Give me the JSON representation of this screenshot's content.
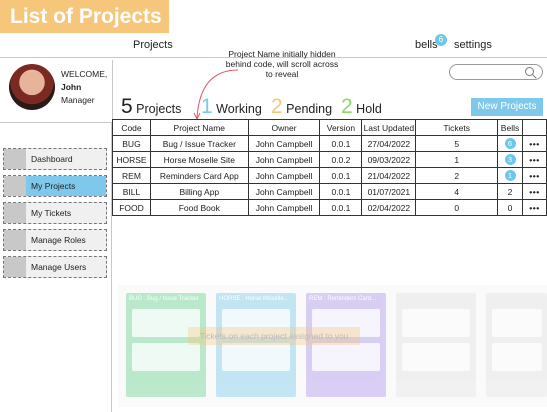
{
  "title": "List of Projects",
  "nav": {
    "projects": "Projects",
    "bells": "bells",
    "bells_badge": "6",
    "settings": "settings"
  },
  "annotation": "Project Name initially hidden behind code, will scroll across to reveal",
  "user": {
    "welcome": "WELCOME,",
    "name": "John",
    "role": "Manager"
  },
  "sidebar": {
    "items": [
      {
        "label": "Dashboard"
      },
      {
        "label": "My Projects"
      },
      {
        "label": "My Tickets"
      },
      {
        "label": "Manage Roles"
      },
      {
        "label": "Manage Users"
      }
    ]
  },
  "stats": {
    "projects_num": "5",
    "projects_label": "Projects",
    "working_num": "1",
    "working_label": "Working",
    "pending_num": "2",
    "pending_label": "Pending",
    "hold_num": "2",
    "hold_label": "Hold"
  },
  "colors": {
    "working": "#7ec8ec",
    "pending": "#f6c67a",
    "hold": "#8fd66a",
    "accent": "#7ec8ec"
  },
  "new_project_label": "New Projects",
  "table": {
    "headers": [
      "Code",
      "Project Name",
      "Owner",
      "Version",
      "Last Updated",
      "Tickets",
      "Bells"
    ],
    "rows": [
      [
        "BUG",
        "Bug / Issue Tracker",
        "John Campbell",
        "0.0.1",
        "27/04/2022",
        "5",
        "6",
        "•••"
      ],
      [
        "HORSE",
        "Horse Moselle Site",
        "John Campbell",
        "0.0.2",
        "09/03/2022",
        "1",
        "3",
        "•••"
      ],
      [
        "REM",
        "Reminders Card App",
        "John Campbell",
        "0.0.1",
        "21/04/2022",
        "2",
        "1",
        "•••"
      ],
      [
        "BILL",
        "Billing App",
        "John Campbell",
        "0.0.1",
        "01/07/2021",
        "4",
        "2",
        "•••"
      ],
      [
        "FOOD",
        "Food Book",
        "John Campbell",
        "0.0.1",
        "02/04/2022",
        "0",
        "0",
        "•••"
      ]
    ]
  },
  "kanban": {
    "overlay": "Tickets on each project assigned to you",
    "columns": [
      "BUG : Bug / Issue Tracker",
      "HORSE : Horse Moselle...",
      "REM : Reminders Card...",
      "",
      ""
    ]
  }
}
